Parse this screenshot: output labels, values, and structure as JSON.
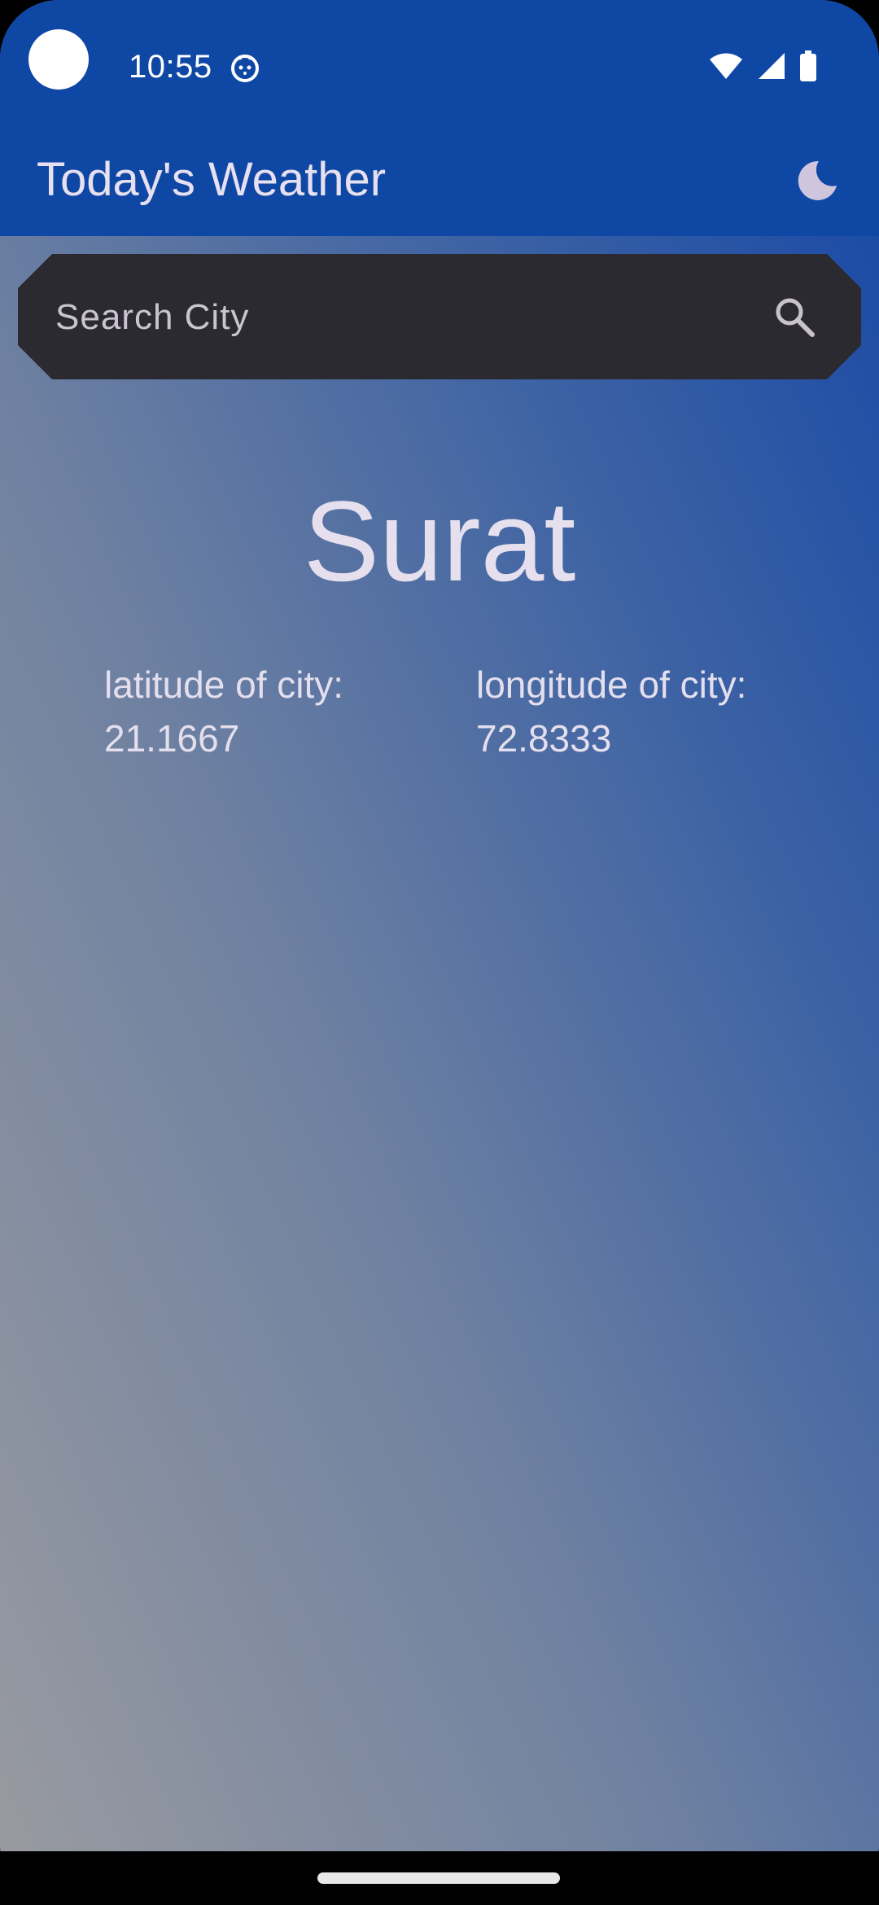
{
  "status_bar": {
    "time": "10:55",
    "icons": [
      "notification-cat-icon",
      "wifi-icon",
      "signal-icon",
      "battery-icon"
    ]
  },
  "app_bar": {
    "title": "Today's Weather",
    "theme_toggle_icon": "moon-icon"
  },
  "search": {
    "placeholder": "Search City",
    "value": "",
    "icon": "search-icon"
  },
  "city": {
    "name": "Surat",
    "latitude_label": "latitude of city:",
    "latitude_value": "21.1667",
    "longitude_label": "longitude of city:",
    "longitude_value": "72.8333"
  },
  "colors": {
    "app_bar": "#0f47a4",
    "search_bg": "#2a2a30",
    "text": "#e6e0ee",
    "gradient_top": "#1446a6",
    "gradient_bottom": "#9a9ba0"
  }
}
